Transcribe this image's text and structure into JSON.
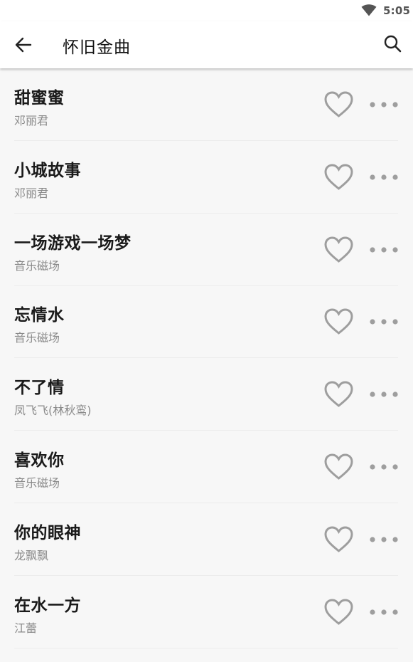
{
  "status_bar": {
    "time": "5:05",
    "wifi_icon": "wifi-icon"
  },
  "app_bar": {
    "title": "怀旧金曲",
    "back_icon": "arrow-left-icon",
    "search_icon": "search-icon"
  },
  "songs": [
    {
      "title": "甜蜜蜜",
      "artist": "邓丽君"
    },
    {
      "title": "小城故事",
      "artist": "邓丽君"
    },
    {
      "title": "一场游戏一场梦",
      "artist": "音乐磁场"
    },
    {
      "title": "忘情水",
      "artist": "音乐磁场"
    },
    {
      "title": "不了情",
      "artist": "凤飞飞(林秋鸾)"
    },
    {
      "title": "喜欢你",
      "artist": "音乐磁场"
    },
    {
      "title": "你的眼神",
      "artist": "龙飘飘"
    },
    {
      "title": "在水一方",
      "artist": "江蕾"
    }
  ],
  "row_icons": {
    "favorite": "heart-outline-icon",
    "more": "more-horizontal-icon"
  },
  "colors": {
    "icon_gray": "#9e9e9e",
    "title_text": "#1a1a1a",
    "subtitle_text": "#8a8a8a"
  }
}
